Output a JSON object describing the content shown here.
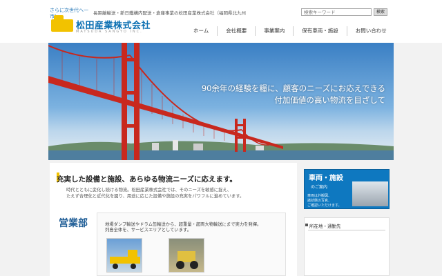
{
  "header": {
    "tagline_1": "さらに次世代へ一",
    "tagline_2": "市)",
    "description": "長距離輸送・新日鐵構内配送・倉庫事業の松田産業株式会社（福岡県北九州",
    "logo_name": "松田産業株式会社",
    "logo_sub": "MATSUDA SANGYO INC.",
    "search_placeholder": "検索キーワード",
    "search_button": "検索"
  },
  "nav": {
    "items": [
      "ホーム",
      "会社概要",
      "事業案内",
      "保有車両・施設",
      "お問い合わせ"
    ]
  },
  "hero": {
    "line_1": "90余年の経験を糧に、顧客のニーズにお応えできる",
    "line_2": "付加価値の高い物流を目ざして"
  },
  "content": {
    "heading": "充実した設備と施設、あらゆる物流ニーズに応えます。",
    "para_1": "時代とともに変化し続ける物流。松田産業株式会社では、そのニーズを敏感に捉え、",
    "para_2": "たえず合理化と近代化を図り、用途に応じた設備や施設の充実をパワフルに進めています。"
  },
  "sales": {
    "title": "営業部",
    "para_1": "地場ダンプ輸送やドラム缶輸送から、超重量・超両大物輸送にまで実力を発揮。",
    "para_2": "列島全体を、サービスエリアとしています。"
  },
  "sidebar": {
    "banner_title": "車両・施設",
    "banner_sub": "のご案内",
    "banner_text_1": "車両は外観図、",
    "banner_text_2": "諸状態の写真、",
    "banner_text_3": "ご確認いただけます。",
    "box_label": "所在地・通勤先"
  },
  "colors": {
    "brand_blue": "#0a6fb2",
    "accent_yellow": "#f2c200",
    "bridge_red": "#c8281e"
  }
}
